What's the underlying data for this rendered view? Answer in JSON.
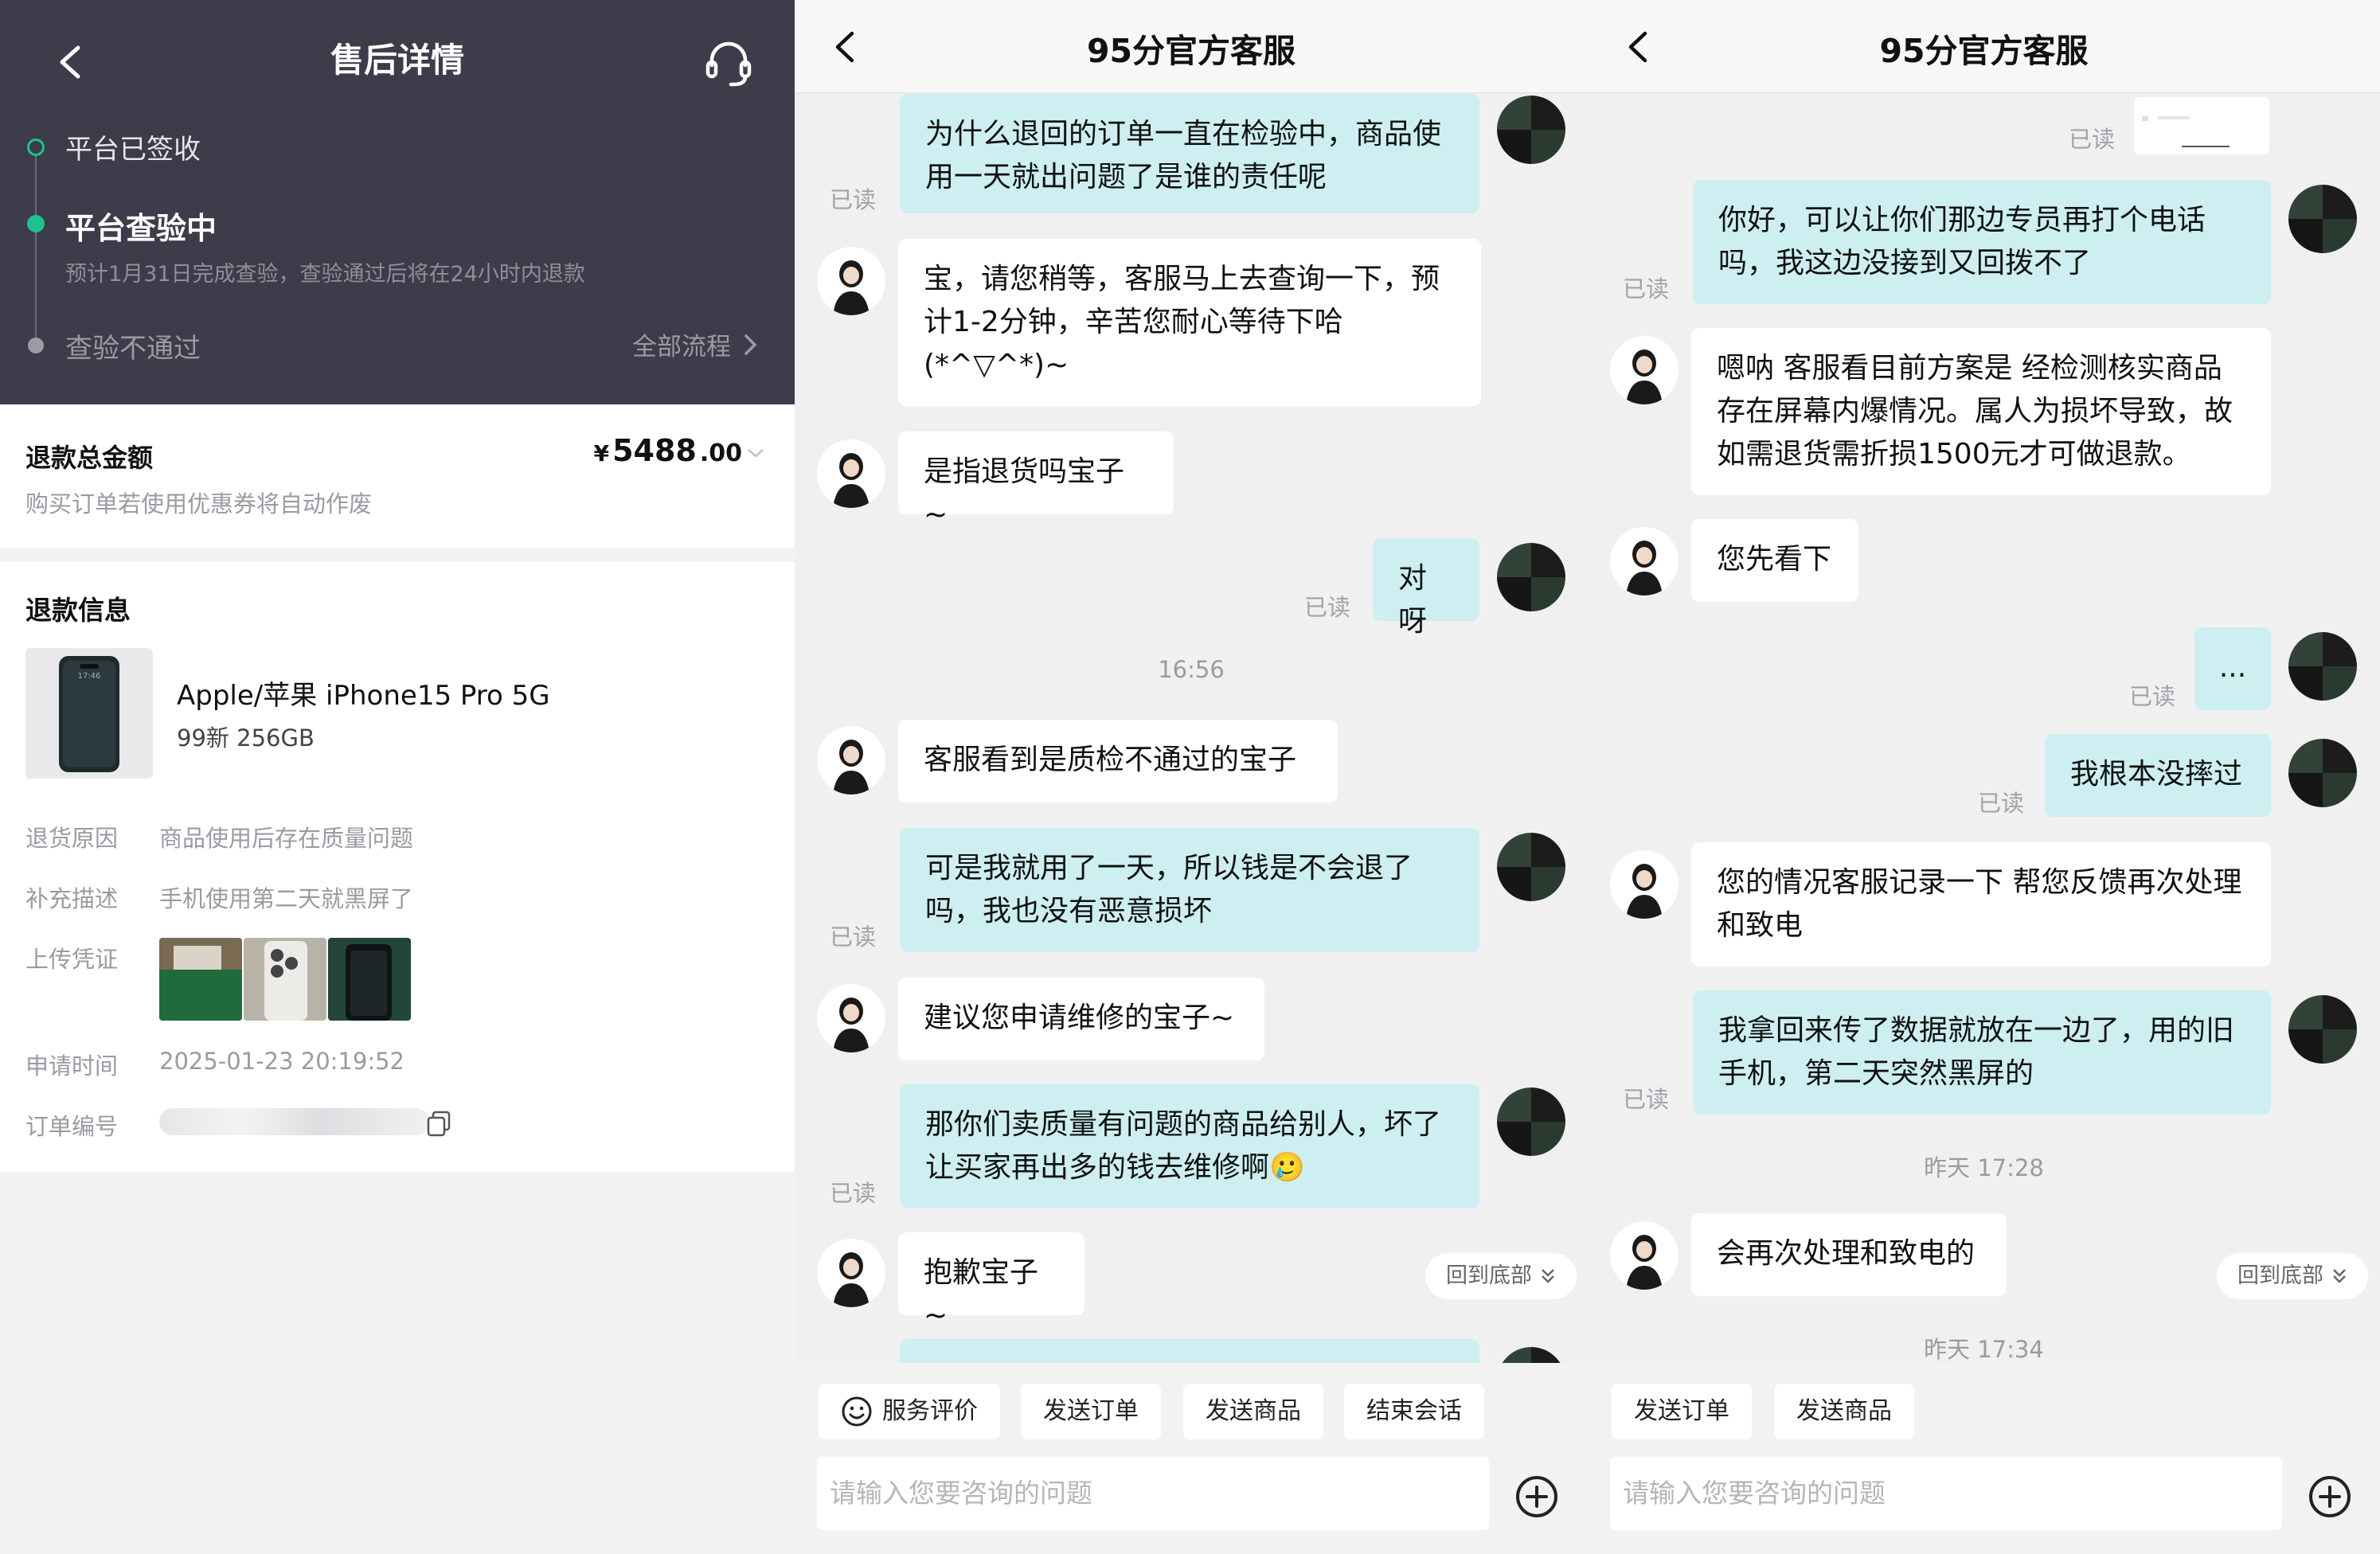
{
  "detail": {
    "title": "售后详情",
    "timeline": {
      "step1": "平台已签收",
      "step2": "平台查验中",
      "step2_note": "预计1月31日完成查验，查验通过后将在24小时内退款",
      "step3": "查验不通过",
      "all_process": "全部流程"
    },
    "refund": {
      "label": "退款总金额",
      "currency": "¥",
      "amount_int": "5488",
      "amount_dec": ".00",
      "note": "购买订单若使用优惠券将自动作废"
    },
    "info": {
      "title": "退款信息",
      "product_name": "Apple/苹果 iPhone15 Pro 5G",
      "product_spec": "99新 256GB",
      "phone_time": "17:46",
      "reason_label": "退货原因",
      "reason_value": "商品使用后存在质量问题",
      "desc_label": "补充描述",
      "desc_value": "手机使用第二天就黑屏了",
      "proof_label": "上传凭证",
      "time_label": "申请时间",
      "time_value": "2025-01-23 20:19:52",
      "order_label": "订单编号"
    }
  },
  "chat_a": {
    "title": "95分官方客服",
    "read": "已读",
    "messages": {
      "m1": "为什么退回的订单一直在检验中，商品使用一天就出问题了是谁的责任呢",
      "m2": "宝，请您稍等，客服马上去查询一下，预计1-2分钟，辛苦您耐心等待下哈(*^▽^*)~",
      "m3": "是指退货吗宝子~",
      "m4": "对呀",
      "time1": "16:56",
      "m5": "客服看到是质检不通过的宝子",
      "m6": "可是我就用了一天，所以钱是不会退了吗，我也没有恶意损坏",
      "m7": "建议您申请维修的宝子~",
      "m8": "那你们卖质量有问题的商品给别人，坏了让买家再出多的钱去维修啊🥲",
      "m9": "抱歉宝子~"
    },
    "to_bottom": "回到底部",
    "chips": [
      "服务评价",
      "发送订单",
      "发送商品",
      "结束会话"
    ],
    "input_placeholder": "请输入您要咨询的问题"
  },
  "chat_b": {
    "title": "95分官方客服",
    "read": "已读",
    "messages": {
      "m1": "你好，可以让你们那边专员再打个电话吗，我这边没接到又回拨不了",
      "m2": "嗯呐 客服看目前方案是 经检测核实商品存在屏幕内爆情况。属人为损坏导致，故如需退货需折损1500元才可做退款。",
      "m3": "您先看下",
      "m4": "...",
      "m5": "我根本没摔过",
      "m6": "您的情况客服记录一下 帮您反馈再次处理和致电",
      "m7": "我拿回来传了数据就放在一边了，用的旧手机，第二天突然黑屏的",
      "time1": "昨天 17:28",
      "m8": "会再次处理和致电的",
      "time2": "昨天 17:34"
    },
    "to_bottom": "回到底部",
    "chips": [
      "发送订单",
      "发送商品"
    ],
    "input_placeholder": "请输入您要咨询的问题"
  },
  "colors": {
    "header_dark": "#3c3c4a",
    "accent_green": "#1fc28b",
    "user_bubble": "#cdeff1"
  },
  "icons": [
    "back-icon",
    "headset-icon",
    "chevron-right-icon",
    "copy-icon",
    "smile-icon",
    "plus-circle-icon",
    "double-chevron-down-icon"
  ]
}
